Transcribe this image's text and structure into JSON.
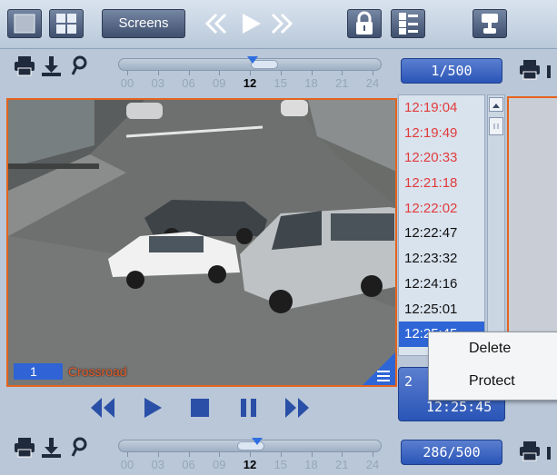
{
  "toolbar": {
    "screens_label": "Screens",
    "icons": [
      "single-layout-icon",
      "grid-layout-icon",
      "rewind-icon",
      "play-icon",
      "fast-forward-icon",
      "lock-icon",
      "list-settings-icon",
      "network-icon"
    ]
  },
  "timeline_top": {
    "ticks": [
      "00",
      "03",
      "06",
      "09",
      "12",
      "15",
      "18",
      "21",
      "24"
    ],
    "current_tick": "12",
    "counter": "1/500"
  },
  "timeline_bottom": {
    "ticks": [
      "00",
      "03",
      "06",
      "09",
      "12",
      "15",
      "18",
      "21",
      "24"
    ],
    "current_tick": "12",
    "counter": "286/500"
  },
  "camera": {
    "number": "1",
    "name": "Crossroad"
  },
  "timelist": {
    "items": [
      "12:19:04",
      "12:19:49",
      "12:20:33",
      "12:21:18",
      "12:22:02",
      "12:22:47",
      "12:23:32",
      "12:24:16",
      "12:25:01",
      "12:25:45"
    ],
    "red_count": 5,
    "selected_index": 9
  },
  "bottom_panel": {
    "top_value": "2",
    "time": "12:25:45"
  },
  "context_menu": {
    "items": [
      "Delete",
      "Protect"
    ]
  },
  "colors": {
    "accent": "#2f66d6",
    "frame": "#e4641e",
    "alert_text": "#e03c3c"
  }
}
